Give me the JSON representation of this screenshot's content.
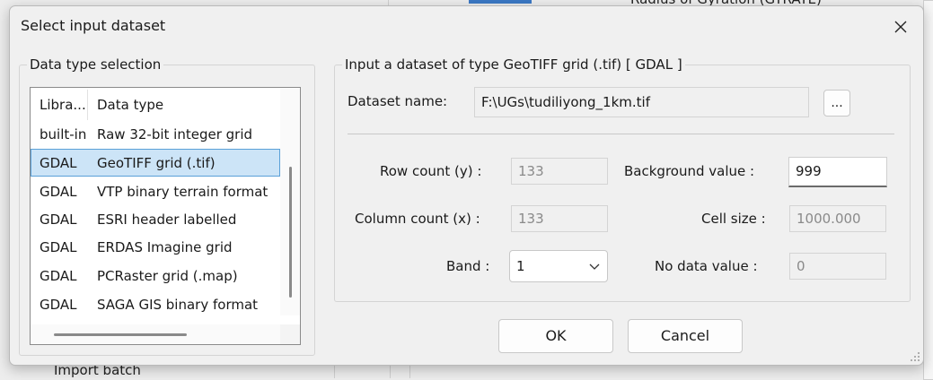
{
  "background": {
    "top_text": "Radius of Gyration (GYRATE)",
    "bottom_text": "Import batch"
  },
  "dialog": {
    "title": "Select input dataset",
    "close_glyph": "✕"
  },
  "data_type_group": {
    "legend": "Data type selection",
    "columns": [
      "Libra...",
      "Data type"
    ],
    "rows": [
      {
        "library": "built-in",
        "type": "Raw 32-bit integer grid"
      },
      {
        "library": "GDAL",
        "type": "GeoTIFF grid (.tif)",
        "selected": true
      },
      {
        "library": "GDAL",
        "type": "VTP binary terrain format"
      },
      {
        "library": "GDAL",
        "type": "ESRI header labelled"
      },
      {
        "library": "GDAL",
        "type": "ERDAS Imagine grid"
      },
      {
        "library": "GDAL",
        "type": "PCRaster grid (.map)"
      },
      {
        "library": "GDAL",
        "type": "SAGA GIS binary format"
      }
    ]
  },
  "input_group": {
    "legend": "Input a dataset of type GeoTIFF grid (.tif) [ GDAL ]",
    "dataset_label": "Dataset name:",
    "dataset_value": "F:\\UGs\\tudiliyong_1km.tif",
    "browse_label": "...",
    "row_count_label": "Row count (y) :",
    "row_count_value": "133",
    "column_count_label": "Column count (x) :",
    "column_count_value": "133",
    "band_label": "Band :",
    "band_value": "1",
    "background_label": "Background value :",
    "background_value": "999",
    "cell_size_label": "Cell size :",
    "cell_size_value": "1000.000",
    "nodata_label": "No data value :",
    "nodata_value": "0"
  },
  "buttons": {
    "ok": "OK",
    "cancel": "Cancel"
  }
}
